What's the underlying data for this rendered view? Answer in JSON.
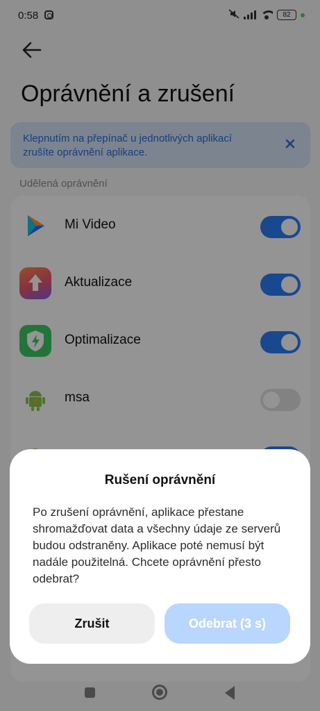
{
  "status_bar": {
    "time": "0:58",
    "battery": "82"
  },
  "header": {
    "title": "Oprávnění a zrušení"
  },
  "banner": {
    "text": "Klepnutím na přepínač u jednotlivých aplikací zrušíte oprávnění aplikace."
  },
  "section_label": "Udělená oprávnění",
  "apps": [
    {
      "name": "Mi Video",
      "icon": "mi-video-icon",
      "granted": true
    },
    {
      "name": "Aktualizace",
      "icon": "update-icon",
      "granted": true
    },
    {
      "name": "Optimalizace",
      "icon": "security-shield-icon",
      "granted": true
    },
    {
      "name": "msa",
      "icon": "android-icon",
      "granted": false
    },
    {
      "name": "",
      "icon": "android-icon",
      "granted": true
    }
  ],
  "dialog": {
    "title": "Rušení oprávnění",
    "message": "Po zrušení oprávnění, aplikace přestane shromažďovat data a všechny údaje ze serverů budou odstraněny. Aplikace poté nemusí být nadále použitelná. Chcete oprávnění přesto odebrat?",
    "cancel_label": "Zrušit",
    "confirm_label": "Odebrat (3 s)"
  },
  "colors": {
    "accent": "#2e7cf6",
    "banner_bg": "#d4e3f7",
    "banner_text": "#2f6bd6"
  }
}
